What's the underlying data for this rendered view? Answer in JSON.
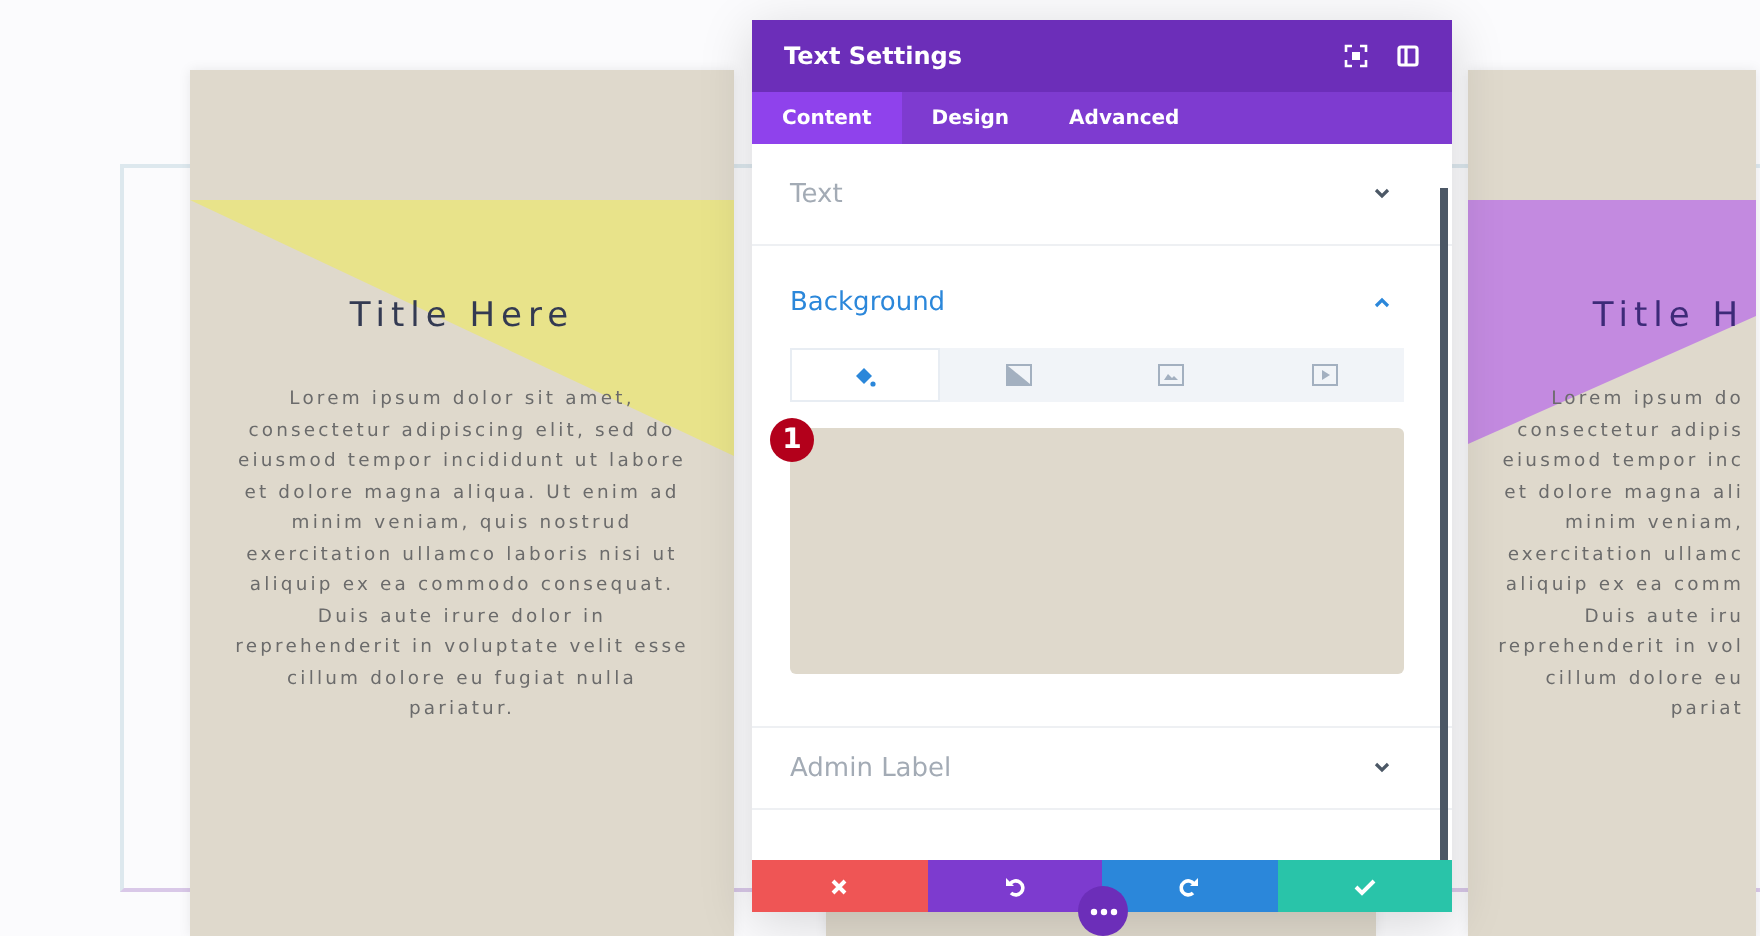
{
  "cards": [
    {
      "title": "Title Here",
      "color": "#e8e38a",
      "lines": [
        "Lorem ipsum dolor sit amet,",
        "consectetur adipiscing elit, sed do",
        "eiusmod tempor incididunt ut labore",
        "et dolore magna aliqua. Ut enim ad",
        "minim veniam, quis nostrud",
        "exercitation ullamco laboris nisi ut",
        "aliquip ex ea commodo consequat.",
        "Duis aute irure dolor in",
        "reprehenderit in voluptate velit esse",
        "cillum dolore eu fugiat nulla",
        "pariatur."
      ]
    },
    {
      "title": "Title H",
      "color": "#c38ae0",
      "lines": [
        "Lorem ipsum do",
        "consectetur adipis",
        "eiusmod tempor inc",
        "et dolore magna ali",
        "minim veniam,",
        "exercitation ullamc",
        "aliquip ex ea comm",
        "Duis aute iru",
        "reprehenderit in vol",
        "cillum dolore eu",
        "pariat"
      ]
    }
  ],
  "panel": {
    "title": "Text Settings",
    "tabs": [
      {
        "label": "Content",
        "selected": true
      },
      {
        "label": "Design",
        "selected": false
      },
      {
        "label": "Advanced",
        "selected": false
      }
    ],
    "sections": [
      {
        "label": "Text",
        "expanded": false
      },
      {
        "label": "Background",
        "expanded": true
      },
      {
        "label": "Admin Label",
        "expanded": false
      }
    ],
    "background_tabs": [
      {
        "kind": "color",
        "selected": true
      },
      {
        "kind": "gradient",
        "selected": false
      },
      {
        "kind": "image",
        "selected": false
      },
      {
        "kind": "video",
        "selected": false
      }
    ],
    "badge": "1",
    "actions": [
      {
        "kind": "cancel"
      },
      {
        "kind": "undo"
      },
      {
        "kind": "redo"
      },
      {
        "kind": "save"
      }
    ]
  }
}
